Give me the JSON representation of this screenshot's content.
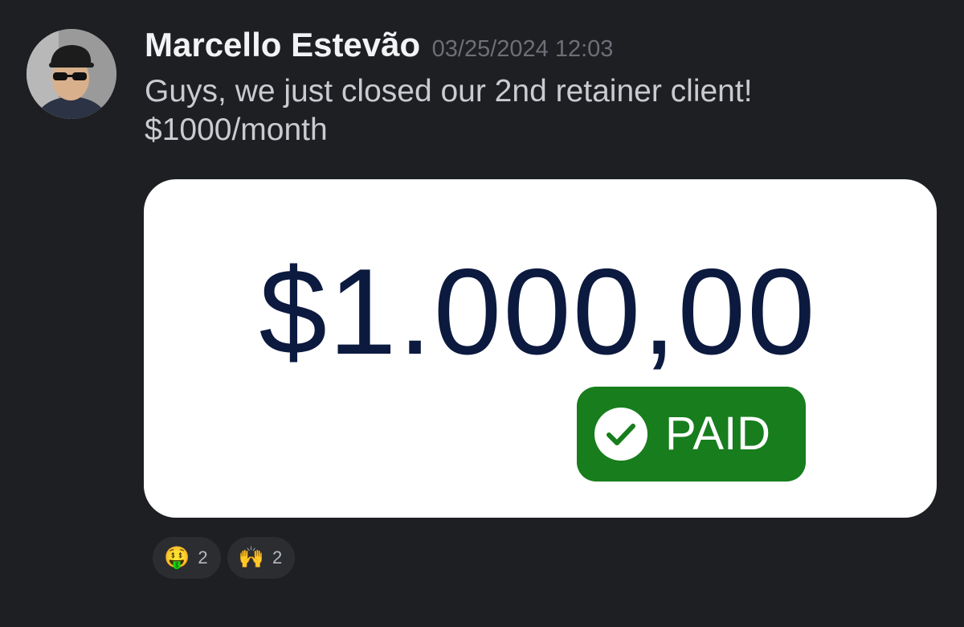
{
  "message": {
    "author": "Marcello Estevão",
    "timestamp": "03/25/2024 12:03",
    "text_lines": [
      "Guys, we just closed our 2nd retainer client!",
      "$1000/month"
    ]
  },
  "attachment": {
    "amount": "$1.000,00",
    "badge_label": "PAID",
    "colors": {
      "amount": "#0c1a3f",
      "badge_bg": "#177d1d",
      "badge_text": "#ffffff"
    }
  },
  "reactions": [
    {
      "emoji": "🤑",
      "icon": "money-mouth-face-icon",
      "count": "2"
    },
    {
      "emoji": "🙌",
      "icon": "raising-hands-icon",
      "count": "2"
    }
  ],
  "theme": {
    "background": "#1e1f22",
    "author_color": "#f2f3f5",
    "text_color": "#c9cbd0",
    "timestamp_color": "#6d6f78"
  }
}
